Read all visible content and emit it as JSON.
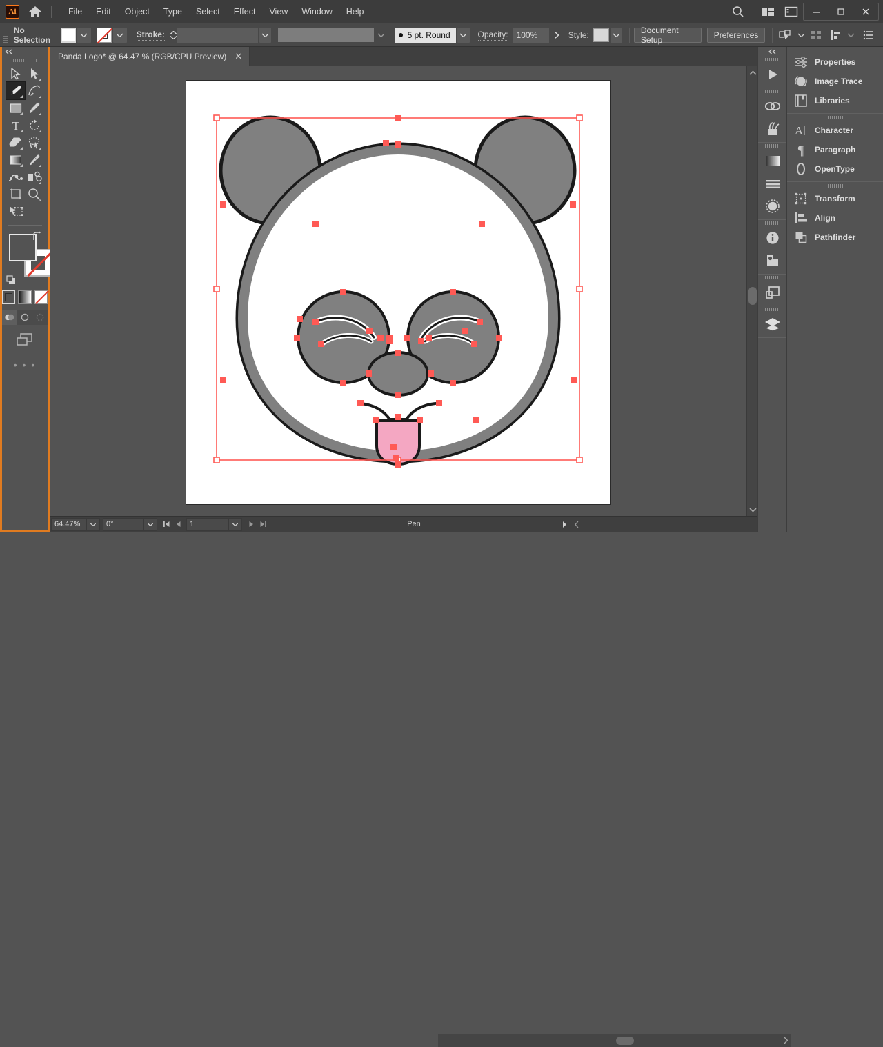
{
  "app": {
    "name": "Adobe Illustrator",
    "logo_text": "Ai",
    "accent_color": "#e07b20"
  },
  "menubar": {
    "items": [
      {
        "label": "File"
      },
      {
        "label": "Edit"
      },
      {
        "label": "Object"
      },
      {
        "label": "Type"
      },
      {
        "label": "Select"
      },
      {
        "label": "Effect"
      },
      {
        "label": "View"
      },
      {
        "label": "Window"
      },
      {
        "label": "Help"
      }
    ],
    "home_icon": "home-icon",
    "search_icon": "search-icon",
    "arrange_icon": "arrange-documents-icon",
    "workspace_icon": "workspace-switcher-icon",
    "window_controls": {
      "minimize": "—",
      "maximize": "□",
      "close": "✕"
    }
  },
  "controlbar": {
    "selection_status": "No Selection",
    "fill_label": "fill-swatch",
    "stroke_swatch_label": "stroke-swatch-none",
    "stroke_label": "Stroke:",
    "stroke_weight_value": "",
    "variable_width_profile": "",
    "brush_definition": "5 pt. Round",
    "opacity_label": "Opacity:",
    "opacity_value": "100%",
    "style_label": "Style:",
    "document_setup_label": "Document Setup",
    "preferences_label": "Preferences",
    "select_similar_icon": "select-similar-objects-icon",
    "align_icon": "align-icon",
    "distribute_icon": "distribute-icon",
    "options_icon": "more-options-icon"
  },
  "toolbar": {
    "selected_tool": "pen-tool",
    "tools": [
      {
        "name": "selection-tool",
        "row": 1,
        "col": 1,
        "has_flyout": false
      },
      {
        "name": "direct-selection-tool",
        "row": 1,
        "col": 2,
        "has_flyout": true
      },
      {
        "name": "pen-tool",
        "row": 2,
        "col": 1,
        "has_flyout": true,
        "selected": true
      },
      {
        "name": "curvature-tool",
        "row": 2,
        "col": 2,
        "has_flyout": true
      },
      {
        "name": "rectangle-tool",
        "row": 3,
        "col": 1,
        "has_flyout": true
      },
      {
        "name": "paintbrush-tool",
        "row": 3,
        "col": 2,
        "has_flyout": true
      },
      {
        "name": "type-tool",
        "row": 4,
        "col": 1,
        "has_flyout": true
      },
      {
        "name": "rotate-tool",
        "row": 4,
        "col": 2,
        "has_flyout": true
      },
      {
        "name": "eraser-tool",
        "row": 5,
        "col": 1,
        "has_flyout": true
      },
      {
        "name": "lasso-tool",
        "row": 5,
        "col": 2,
        "has_flyout": true
      },
      {
        "name": "gradient-tool",
        "row": 6,
        "col": 1,
        "has_flyout": true
      },
      {
        "name": "eyedropper-tool",
        "row": 6,
        "col": 2,
        "has_flyout": true
      },
      {
        "name": "blend-tool",
        "row": 7,
        "col": 1,
        "has_flyout": false
      },
      {
        "name": "symbol-sprayer-tool",
        "row": 7,
        "col": 2,
        "has_flyout": true
      },
      {
        "name": "artboard-tool",
        "row": 8,
        "col": 1,
        "has_flyout": false
      },
      {
        "name": "zoom-tool",
        "row": 8,
        "col": 2,
        "has_flyout": true
      },
      {
        "name": "free-transform-tool",
        "row": 9,
        "col": 1,
        "has_flyout": false
      }
    ],
    "fill_color": "#535353",
    "stroke_color": "none",
    "color_modes": [
      "color-mode",
      "gradient-mode",
      "none-mode"
    ],
    "drawing_modes": [
      "draw-normal",
      "draw-behind",
      "draw-inside"
    ],
    "screen_mode_icon": "screen-mode-icon",
    "edit_toolbar_label": "• • •"
  },
  "document": {
    "tab_title": "Panda Logo* @ 64.47 % (RGB/CPU Preview)",
    "tab_close": "✕",
    "artwork": {
      "name": "panda-logo-artwork",
      "selected": true,
      "colors": {
        "gray_fill": "#808080",
        "outline": "#1a1a1a",
        "pink_fill": "#f4a7c2",
        "white_fill": "#ffffff",
        "selection": "#ff5a55"
      }
    }
  },
  "statusbar": {
    "zoom_value": "64.47%",
    "rotation_value": "0°",
    "page_value": "1",
    "active_tool": "Pen",
    "first_page_icon": "first-page-icon",
    "prev_page_icon": "previous-page-icon",
    "next_page_icon": "next-page-icon",
    "last_page_icon": "last-page-icon"
  },
  "icon_column": {
    "collapse_icon": "collapse-panels-icon",
    "groups": [
      {
        "icons": [
          {
            "name": "play-actions-icon"
          }
        ]
      },
      {
        "icons": [
          {
            "name": "links-icon"
          },
          {
            "name": "symbols-icon"
          }
        ]
      },
      {
        "icons": [
          {
            "name": "gradient-icon"
          },
          {
            "name": "stroke-panel-icon"
          },
          {
            "name": "transparency-icon"
          }
        ]
      },
      {
        "icons": [
          {
            "name": "document-info-icon"
          },
          {
            "name": "asset-export-icon"
          }
        ]
      },
      {
        "icons": [
          {
            "name": "artboards-icon"
          }
        ]
      },
      {
        "icons": [
          {
            "name": "layers-icon"
          }
        ]
      }
    ]
  },
  "panel_column": {
    "groups": [
      {
        "items": [
          {
            "label": "Properties",
            "icon": "properties-icon"
          },
          {
            "label": "Image Trace",
            "icon": "image-trace-icon"
          },
          {
            "label": "Libraries",
            "icon": "libraries-icon"
          }
        ]
      },
      {
        "items": [
          {
            "label": "Character",
            "icon": "character-icon"
          },
          {
            "label": "Paragraph",
            "icon": "paragraph-icon"
          },
          {
            "label": "OpenType",
            "icon": "opentype-icon"
          }
        ]
      },
      {
        "items": [
          {
            "label": "Transform",
            "icon": "transform-icon"
          },
          {
            "label": "Align",
            "icon": "align-panel-icon"
          },
          {
            "label": "Pathfinder",
            "icon": "pathfinder-icon"
          }
        ]
      }
    ]
  }
}
